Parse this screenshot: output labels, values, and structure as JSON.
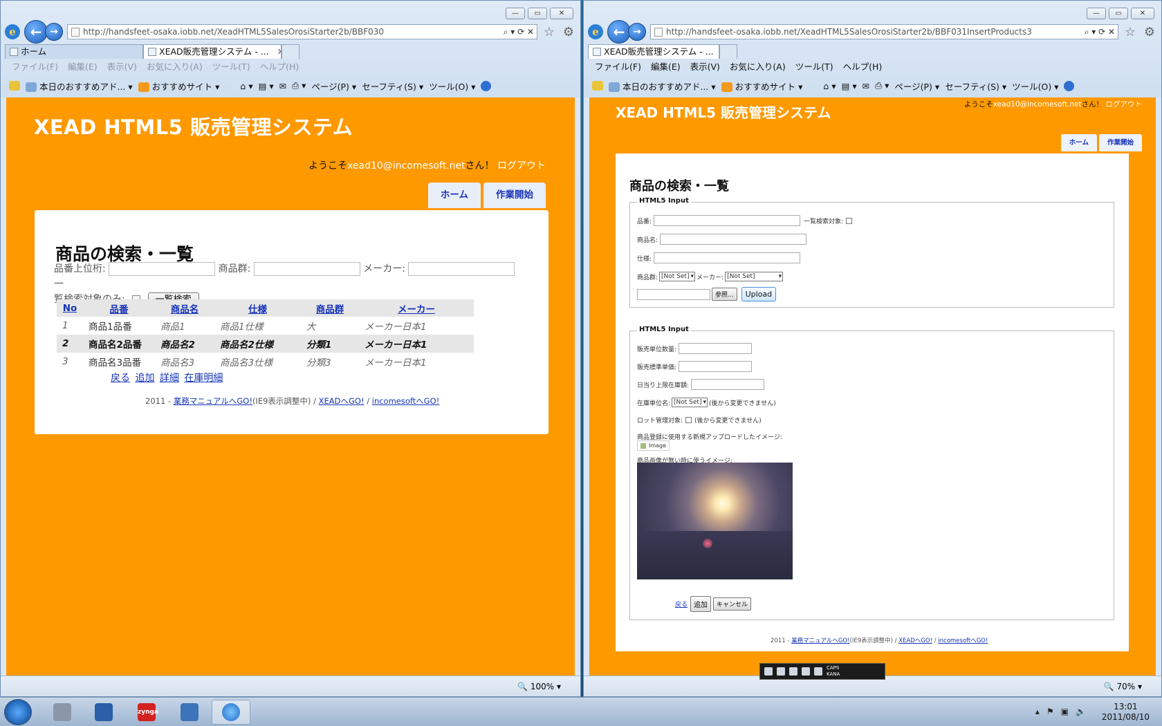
{
  "left_window": {
    "url": "http://handsfeet-osaka.iobb.net/XeadHTML5SalesOrosiStarter2b/BBF030",
    "tabs": [
      {
        "label": "ホーム"
      },
      {
        "label": "XEAD販売管理システム - ..."
      }
    ],
    "menu": [
      "ファイル(F)",
      "編集(E)",
      "表示(V)",
      "お気に入り(A)",
      "ツール(T)",
      "ヘルプ(H)"
    ],
    "cmd": {
      "fav1": "本日のおすすめアド...",
      "fav2": "おすすめサイト",
      "page": "ページ(P)",
      "safety": "セーフティ(S)",
      "tools": "ツール(O)"
    },
    "zoom": "100%",
    "page": {
      "site_title": "XEAD HTML5 販売管理システム",
      "welcome_prefix": "ようこそ",
      "user": "xead10@incomesoft.net",
      "welcome_suffix": "さん！",
      "logout": "ログアウト",
      "nav_home": "ホーム",
      "nav_start": "作業開始",
      "heading": "商品の検索・一覧",
      "form": {
        "label_code": "品番上位桁:",
        "label_group": "商品群:",
        "label_maker": "メーカー:",
        "label_onlylist": "一覧検索対象のみ:",
        "label_onlylist_head": "一",
        "label_onlylist_tail": "覧検索対象のみ:",
        "search_button": "一覧検索"
      },
      "table": {
        "headers": [
          "No",
          "品番",
          "商品名",
          "仕様",
          "商品群",
          "メーカー"
        ],
        "rows": [
          [
            "1",
            "商品1品番",
            "商品1",
            "商品1仕様",
            "大",
            "メーカー日本1"
          ],
          [
            "2",
            "商品名2品番",
            "商品名2",
            "商品名2仕様",
            "分類1",
            "メーカー日本1"
          ],
          [
            "3",
            "商品名3品番",
            "商品名3",
            "商品名3仕様",
            "分類3",
            "メーカー日本1"
          ]
        ]
      },
      "links": [
        "戻る",
        "追加",
        "詳細",
        "在庫明細"
      ],
      "footer": {
        "year": "2011 - ",
        "link1": "業務マニュアルへGO!",
        "note": "(IE9表示調整中) / ",
        "link2": "XEADへGO!",
        "sep": " / ",
        "link3": "incomesoftへGO!"
      }
    }
  },
  "right_window": {
    "url": "http://handsfeet-osaka.iobb.net/XeadHTML5SalesOrosiStarter2b/BBF031InsertProducts3",
    "tabs": [
      {
        "label": "XEAD販売管理システム - ..."
      }
    ],
    "menu": [
      "ファイル(F)",
      "編集(E)",
      "表示(V)",
      "お気に入り(A)",
      "ツール(T)",
      "ヘルプ(H)"
    ],
    "cmd": {
      "fav1": "本日のおすすめアド...",
      "fav2": "おすすめサイト",
      "page": "ページ(P)",
      "safety": "セーフティ(S)",
      "tools": "ツール(O)"
    },
    "zoom": "70%",
    "page": {
      "site_title": "XEAD HTML5 販売管理システム",
      "welcome_prefix": "ようこそ",
      "user": "xead10@incomesoft.net",
      "welcome_suffix": "さん！",
      "logout": "ログアウト",
      "nav_home": "ホーム",
      "nav_start": "作業開始",
      "heading": "商品の検索・一覧",
      "fieldset1": {
        "legend": "HTML5 Input",
        "label_code": "品番:",
        "label_listtarget": "一覧検索対象:",
        "label_name": "商品名:",
        "label_spec": "仕様:",
        "label_group": "商品群:",
        "group_value": "[Not Set]",
        "label_maker": "メーカー:",
        "maker_value": "[Not Set]",
        "browse_button": "参照...",
        "upload_button": "Upload"
      },
      "fieldset2": {
        "legend": "HTML5 Input",
        "label_unit_qty": "販売単位数量:",
        "label_std_price": "販売標準単価:",
        "label_daily_limit": "日当り上限在庫額:",
        "label_stock_unit": "在庫単位名:",
        "stock_unit_value": "[Not Set]",
        "stock_unit_note": "(後から変更できません)",
        "label_lot": "ロット管理対象:",
        "lot_note": "(後から変更できません)",
        "label_new_image": "商品登録に使用する新規アップロードしたイメージ:",
        "image_alt": "Image",
        "label_default_image": "商品画像が無い時に使うイメージ:",
        "back_link": "戻る",
        "add_button": "追加",
        "cancel_button": "キャンセル"
      },
      "footer": {
        "year": "2011 - ",
        "link1": "業務マニュアルへGO!",
        "note": "(IE9表示調整中) / ",
        "link2": "XEADへGO!",
        "sep": " / ",
        "link3": "incomesoftへGO!"
      }
    }
  },
  "ime": {
    "caps": "CAPS",
    "kana": "KANA"
  },
  "taskbar": {
    "items": [
      {
        "icon": "windows-start-icon"
      },
      {
        "icon": "computer-management-icon"
      },
      {
        "icon": "powershell-icon"
      },
      {
        "icon": "zynga-icon",
        "label": "zynga"
      },
      {
        "icon": "remote-desktop-icon"
      },
      {
        "icon": "internet-explorer-icon"
      }
    ],
    "time": "13:01",
    "date": "2011/08/10"
  },
  "colors": {
    "page_bg": "#ff9900",
    "link": "#1533b8",
    "panel": "#ffffff"
  }
}
